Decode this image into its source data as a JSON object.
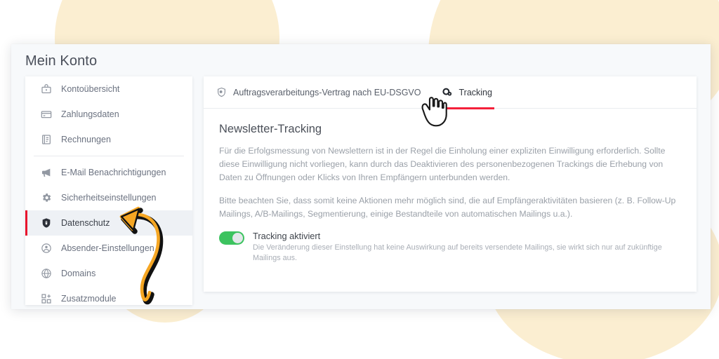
{
  "window": {
    "title": "Mein Konto"
  },
  "sidebar": {
    "items": [
      {
        "label": "Kontoübersicht",
        "icon": "account-overview-icon",
        "active": false,
        "divider_after": false
      },
      {
        "label": "Zahlungsdaten",
        "icon": "credit-card-icon",
        "active": false,
        "divider_after": false
      },
      {
        "label": "Rechnungen",
        "icon": "invoice-icon",
        "active": false,
        "divider_after": true
      },
      {
        "label": "E-Mail Benachrichtigungen",
        "icon": "megaphone-icon",
        "active": false,
        "divider_after": false
      },
      {
        "label": "Sicherheitseinstellungen",
        "icon": "gear-icon",
        "active": false,
        "divider_after": false
      },
      {
        "label": "Datenschutz",
        "icon": "shield-lock-icon",
        "active": true,
        "divider_after": false
      },
      {
        "label": "Absender-Einstellungen",
        "icon": "user-circle-icon",
        "active": false,
        "divider_after": false
      },
      {
        "label": "Domains",
        "icon": "globe-icon",
        "active": false,
        "divider_after": false
      },
      {
        "label": "Zusatzmodule",
        "icon": "modules-grid-icon",
        "active": false,
        "divider_after": false
      }
    ]
  },
  "tabs": [
    {
      "label": "Auftragsverarbeitungs-Vertrag nach EU-DSGVO",
      "icon": "shield-check-icon",
      "active": false
    },
    {
      "label": "Tracking",
      "icon": "tracking-gear-icon",
      "active": true
    }
  ],
  "content": {
    "heading": "Newsletter-Tracking",
    "paragraph_1": "Für die Erfolgsmessung von Newslettern ist in der Regel die Einholung einer expliziten Einwilligung erforderlich. Sollte diese Einwilligung nicht vorliegen, kann durch das Deaktivieren des personenbezogenen Trackings die Erhebung von Daten zu Öffnungen oder Klicks von Ihren Empfängern unterbunden werden.",
    "paragraph_2": "Bitte beachten Sie, dass somit keine Aktionen mehr möglich sind, die auf Empfängeraktivitäten basieren (z. B. Follow-Up Mailings, A/B-Mailings, Segmentierung, einige Bestandteile von automatischen Mailings u.a.).",
    "toggle": {
      "label": "Tracking aktiviert",
      "hint": "Die Veränderung dieser Einstellung hat keine Auswirkung auf bereits versendete Mailings, sie wirkt sich nur auf zukünftige Mailings aus.",
      "state_on": true
    }
  },
  "annotations": {
    "arrow": "curved-orange-arrow",
    "cursor": "pointing-hand-cursor"
  },
  "colors": {
    "accent_red": "#e8142d",
    "tab_underline_red": "#f4203a",
    "toggle_green": "#3cc35f",
    "arrow_orange": "#f5a623",
    "blob_cream": "#fbeed1",
    "window_bg": "#f7f9fb"
  }
}
